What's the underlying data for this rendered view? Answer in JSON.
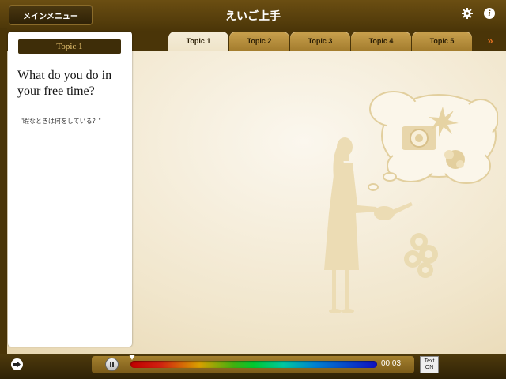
{
  "header": {
    "menu_button_label": "メインメニュー",
    "title": "えいご上手",
    "settings_icon": "gear-icon",
    "info_icon": "info-icon",
    "info_glyph": "i"
  },
  "tabs": [
    {
      "label": "Topic 1",
      "active": true
    },
    {
      "label": "Topic 2",
      "active": false
    },
    {
      "label": "Topic 3",
      "active": false
    },
    {
      "label": "Topic 4",
      "active": false
    },
    {
      "label": "Topic 5",
      "active": false
    }
  ],
  "more_tabs_glyph": "»",
  "topic_card": {
    "badge": "Topic 1",
    "question": "What do you do in your free time?",
    "translation": "\"暇なときは何をしている？\""
  },
  "player": {
    "time": "00:03",
    "progress": 0.0,
    "state": "playing",
    "text_toggle_line1": "Text",
    "text_toggle_line2": "ON"
  },
  "colors": {
    "accent": "#e07020",
    "bar_dark": "#4a3508",
    "tab_gold": "#b58c3a"
  }
}
